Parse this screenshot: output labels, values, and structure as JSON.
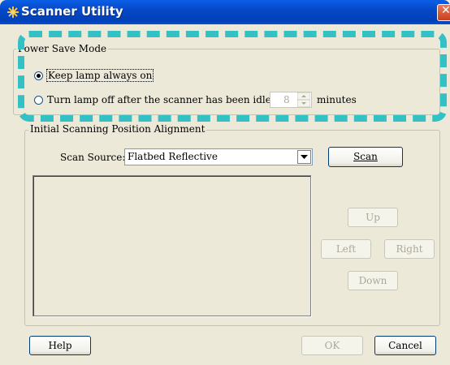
{
  "window": {
    "title": "Scanner Utility",
    "close_glyph": "✕",
    "accent": "#0648c7"
  },
  "power_save": {
    "group_label": "Power Save Mode",
    "option_keep": "Keep lamp always on",
    "option_turn_off_prefix": "Turn lamp off after the scanner has been idle for",
    "idle_value": "8",
    "idle_unit": "minutes",
    "selected": "keep"
  },
  "alignment": {
    "group_label": "Initial Scanning Position Alignment",
    "scan_source_label": "Scan Source:",
    "scan_source_value": "Flatbed Reflective",
    "scan_button": "Scan",
    "up_button": "Up",
    "left_button": "Left",
    "right_button": "Right",
    "down_button": "Down"
  },
  "footer": {
    "help_button": "Help",
    "ok_button": "OK",
    "cancel_button": "Cancel"
  },
  "highlight_color": "#33c1c6"
}
